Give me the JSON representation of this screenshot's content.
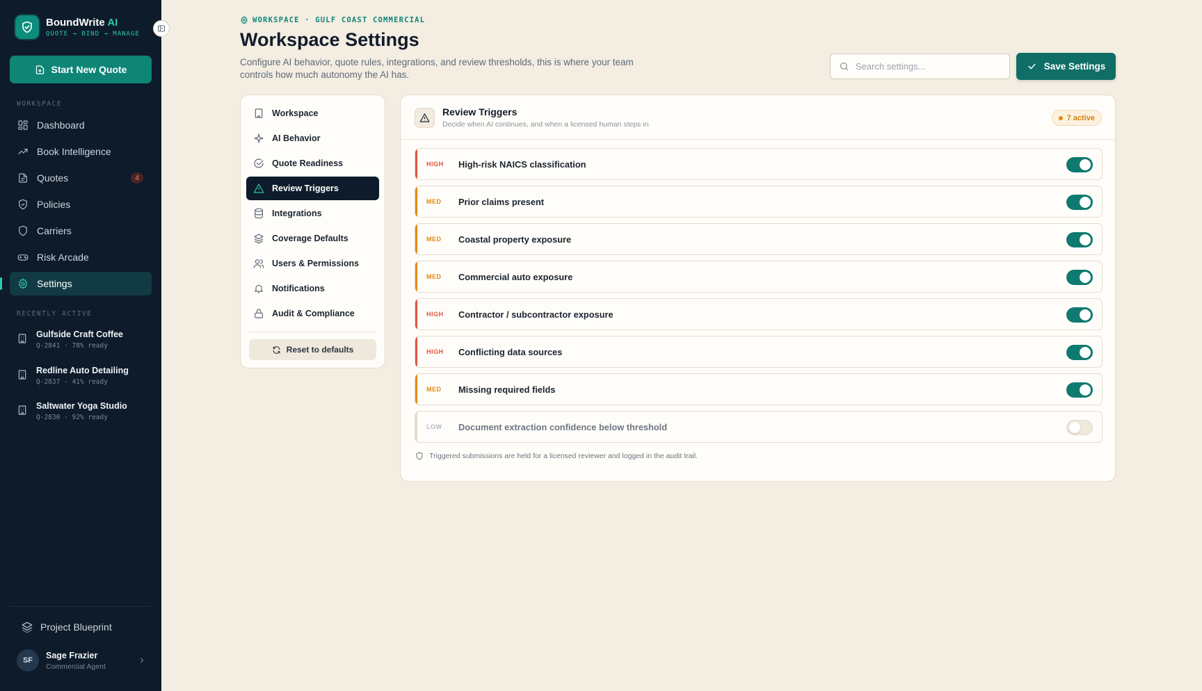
{
  "brand": {
    "name": "BoundWrite",
    "name_ai": " AI",
    "tagline": "QUOTE → BIND → MANAGE"
  },
  "sidebar": {
    "new_quote_label": "Start New Quote",
    "section_workspace": "WORKSPACE",
    "items": [
      {
        "label": "Dashboard",
        "icon": "grid-icon"
      },
      {
        "label": "Book Intelligence",
        "icon": "trend-icon"
      },
      {
        "label": "Quotes",
        "icon": "document-icon",
        "badge": "4"
      },
      {
        "label": "Policies",
        "icon": "shield-icon"
      },
      {
        "label": "Carriers",
        "icon": "shield-outline-icon"
      },
      {
        "label": "Risk Arcade",
        "icon": "gamepad-icon"
      },
      {
        "label": "Settings",
        "icon": "gear-icon",
        "active": true
      }
    ],
    "section_recent": "RECENTLY ACTIVE",
    "recent": [
      {
        "name": "Gulfside Craft Coffee",
        "meta": "Q-2841 · 78% ready"
      },
      {
        "name": "Redline Auto Detailing",
        "meta": "Q-2837 · 41% ready"
      },
      {
        "name": "Saltwater Yoga Studio",
        "meta": "Q-2830 · 92% ready"
      }
    ],
    "blueprint_label": "Project Blueprint",
    "user": {
      "initials": "SF",
      "name": "Sage Frazier",
      "role": "Commercial Agent"
    }
  },
  "header": {
    "breadcrumb": "WORKSPACE · GULF COAST COMMERCIAL",
    "title": "Workspace Settings",
    "description": "Configure AI behavior, quote rules, integrations, and review thresholds, this is where your team controls how much autonomy the AI has.",
    "search_placeholder": "Search settings...",
    "save_label": "Save Settings"
  },
  "settings_nav": {
    "items": [
      {
        "label": "Workspace",
        "icon": "building-icon"
      },
      {
        "label": "AI Behavior",
        "icon": "sparkle-icon"
      },
      {
        "label": "Quote Readiness",
        "icon": "check-circle-icon"
      },
      {
        "label": "Review Triggers",
        "icon": "warning-icon",
        "active": true
      },
      {
        "label": "Integrations",
        "icon": "database-icon"
      },
      {
        "label": "Coverage Defaults",
        "icon": "layers-icon"
      },
      {
        "label": "Users & Permissions",
        "icon": "users-icon"
      },
      {
        "label": "Notifications",
        "icon": "bell-icon"
      },
      {
        "label": "Audit & Compliance",
        "icon": "lock-icon"
      }
    ],
    "reset_label": "Reset to defaults"
  },
  "triggers": {
    "title": "Review Triggers",
    "subtitle": "Decide when AI continues, and when a licensed human steps in",
    "active_count": "7 active",
    "rows": [
      {
        "severity": "HIGH",
        "label": "High-risk NAICS classification",
        "enabled": true
      },
      {
        "severity": "MED",
        "label": "Prior claims present",
        "enabled": true
      },
      {
        "severity": "MED",
        "label": "Coastal property exposure",
        "enabled": true
      },
      {
        "severity": "MED",
        "label": "Commercial auto exposure",
        "enabled": true
      },
      {
        "severity": "HIGH",
        "label": "Contractor / subcontractor exposure",
        "enabled": true
      },
      {
        "severity": "HIGH",
        "label": "Conflicting data sources",
        "enabled": true
      },
      {
        "severity": "MED",
        "label": "Missing required fields",
        "enabled": true
      },
      {
        "severity": "LOW",
        "label": "Document extraction confidence below threshold",
        "enabled": false
      }
    ],
    "footer_note": "Triggered submissions are held for a licensed reviewer and logged in the audit trail."
  },
  "colors": {
    "accent": "#0f8576",
    "high": "#e0553f",
    "med": "#e38a12",
    "sidebar_bg": "#0d1b2a",
    "page_bg": "#f3ede2"
  }
}
